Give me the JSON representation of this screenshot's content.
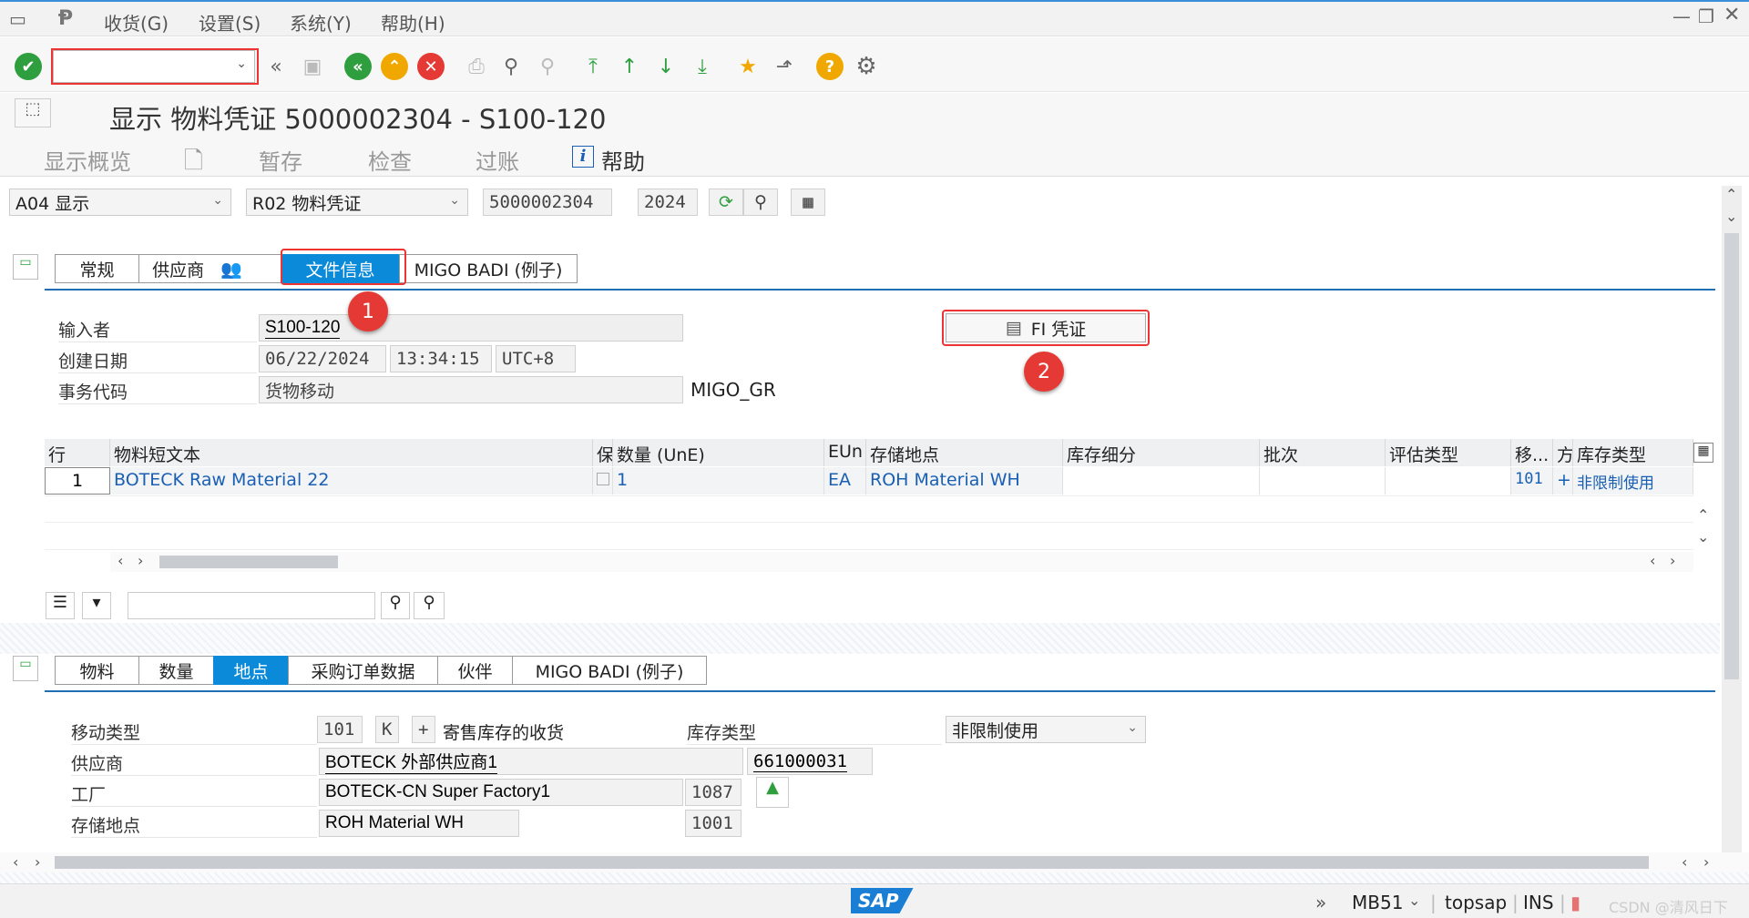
{
  "menu": {
    "items": [
      "收货(G)",
      "设置(S)",
      "系统(Y)",
      "帮助(H)"
    ]
  },
  "title": "显示 物料凭证 5000002304 - S100-120",
  "app_toolbar": {
    "overview": "显示概览",
    "hold": "暂存",
    "check": "检查",
    "post": "过账",
    "help": "帮助"
  },
  "header": {
    "action": "A04 显示",
    "reference": "R02 物料凭证",
    "doc_number": "5000002304",
    "year": "2024"
  },
  "header_tabs": [
    "常规",
    "供应商",
    "文件信息",
    "MIGO BADI (例子)"
  ],
  "doc_info": {
    "entered_by_label": "输入者",
    "entered_by": "S100-120",
    "created_on_label": "创建日期",
    "date": "06/22/2024",
    "time": "13:34:15",
    "tz": "UTC+8",
    "tcode_label": "事务代码",
    "tcode_desc": "货物移动",
    "tcode": "MIGO_GR",
    "fi_button": "FI 凭证"
  },
  "annotations": {
    "one": "1",
    "two": "2"
  },
  "grid": {
    "headers": [
      "行",
      "物料短文本",
      "保",
      "数量 (UnE)",
      "EUn",
      "存储地点",
      "库存细分",
      "批次",
      "评估类型",
      "移...",
      "方",
      "库存类型"
    ],
    "row": {
      "line": "1",
      "material": "BOTECK Raw Material 22",
      "qty": "1",
      "unit": "EA",
      "sloc": "ROH Material WH",
      "mvt": "101",
      "dir": "+",
      "stock_type": "非限制使用"
    }
  },
  "item_tabs": [
    "物料",
    "数量",
    "地点",
    "采购订单数据",
    "伙伴",
    "MIGO BADI (例子)"
  ],
  "item_detail": {
    "mvt_label": "移动类型",
    "mvt": "101",
    "special": "K",
    "sign": "+",
    "mvt_desc": "寄售库存的收货",
    "stock_type_label": "库存类型",
    "stock_type": "非限制使用",
    "vendor_label": "供应商",
    "vendor": "BOTECK 外部供应商1",
    "vendor_no": "661000031",
    "plant_label": "工厂",
    "plant": "BOTECK-CN Super Factory1",
    "plant_no": "1087",
    "sloc_label": "存储地点",
    "sloc": "ROH Material WH",
    "sloc_no": "1001"
  },
  "status": {
    "logo": "SAP",
    "tcode": "MB51",
    "system": "topsap",
    "mode": "INS",
    "watermark": "CSDN @清风日下"
  },
  "colors": {
    "accent": "#0a8ad8",
    "annotation": "#e53935",
    "ok": "#2e9e3e",
    "help": "#f0a800"
  }
}
